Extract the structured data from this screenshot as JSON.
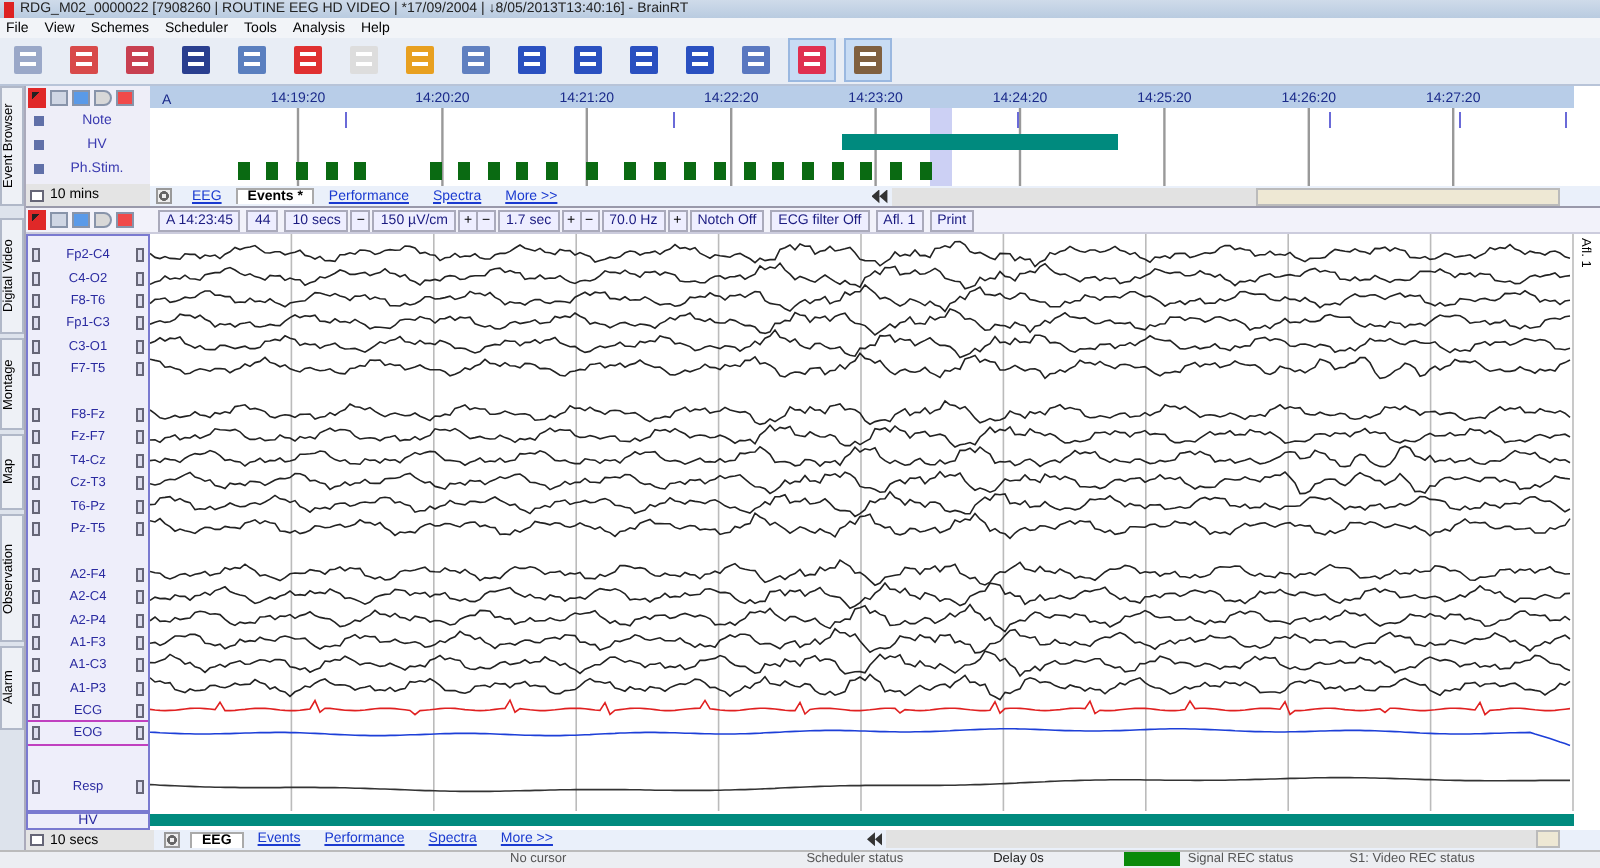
{
  "window": {
    "title": "RDG_M02_0000022 [7908260 | ROUTINE EEG HD VIDEO | *17/09/2004 | ↓8/05/2013T13:40:16] - BrainRT"
  },
  "menu": [
    "File",
    "View",
    "Schemes",
    "Scheduler",
    "Tools",
    "Analysis",
    "Help"
  ],
  "toolbar_buttons": [
    {
      "selected": false
    },
    {
      "selected": false
    },
    {
      "selected": false
    },
    {
      "selected": false
    },
    {
      "selected": false
    },
    {
      "selected": false
    },
    {
      "selected": false
    },
    {
      "selected": false
    },
    {
      "selected": false
    },
    {
      "selected": false
    },
    {
      "selected": false
    },
    {
      "selected": false
    },
    {
      "selected": false
    },
    {
      "selected": false
    },
    {
      "selected": true
    },
    {
      "selected": true
    }
  ],
  "side_tabs": [
    "Event Browser",
    "Digital Video",
    "Montage",
    "Map",
    "Observation",
    "Alarm"
  ],
  "event_browser": {
    "ruler_start": "A",
    "times": [
      "14:19:20",
      "14:20:20",
      "14:21:20",
      "14:22:20",
      "14:23:20",
      "14:24:20",
      "14:25:20",
      "14:26:20",
      "14:27:20"
    ],
    "rows": [
      "Note",
      "HV",
      "Ph.Stim."
    ],
    "span": "10 mins",
    "tabs": [
      {
        "label": "EEG",
        "selected": false
      },
      {
        "label": "Events *",
        "selected": true
      },
      {
        "label": "Performance",
        "selected": false
      },
      {
        "label": "Spectra",
        "selected": false
      },
      {
        "label": "More >>",
        "selected": false
      }
    ]
  },
  "eeg_toolbar": [
    {
      "label": "A 14:23:45",
      "kind": "field"
    },
    {
      "label": "44",
      "kind": "field"
    },
    {
      "label": "10 secs",
      "kind": "field"
    },
    {
      "label": "−",
      "kind": "button"
    },
    {
      "label": "150 µV/cm",
      "kind": "field"
    },
    {
      "label": "+",
      "kind": "button"
    },
    {
      "label": "−",
      "kind": "button"
    },
    {
      "label": "1.7 sec",
      "kind": "field"
    },
    {
      "label": "+",
      "kind": "button"
    },
    {
      "label": "−",
      "kind": "button"
    },
    {
      "label": "70.0 Hz",
      "kind": "field"
    },
    {
      "label": "+",
      "kind": "button"
    },
    {
      "label": "Notch Off",
      "kind": "field"
    },
    {
      "label": "ECG filter Off",
      "kind": "field"
    },
    {
      "label": "Afl. 1",
      "kind": "field"
    },
    {
      "label": "Print",
      "kind": "field"
    }
  ],
  "side_label": "Afl. 1",
  "channel_groups": [
    {
      "channels": [
        {
          "label": "Fp2-C4",
          "kind": "eeg"
        },
        {
          "label": "C4-O2",
          "kind": "eeg"
        },
        {
          "label": "F8-T6",
          "kind": "eeg"
        },
        {
          "label": "Fp1-C3",
          "kind": "eeg"
        },
        {
          "label": "C3-O1",
          "kind": "eeg"
        },
        {
          "label": "F7-T5",
          "kind": "eeg"
        }
      ]
    },
    {
      "channels": [
        {
          "label": "F8-Fz",
          "kind": "eeg"
        },
        {
          "label": "Fz-F7",
          "kind": "eeg"
        },
        {
          "label": "T4-Cz",
          "kind": "eeg"
        },
        {
          "label": "Cz-T3",
          "kind": "eeg"
        },
        {
          "label": "T6-Pz",
          "kind": "eeg"
        },
        {
          "label": "Pz-T5",
          "kind": "eeg"
        }
      ]
    },
    {
      "channels": [
        {
          "label": "A2-F4",
          "kind": "eeg"
        },
        {
          "label": "A2-C4",
          "kind": "eeg"
        },
        {
          "label": "A2-P4",
          "kind": "eeg"
        },
        {
          "label": "A1-F3",
          "kind": "eeg"
        },
        {
          "label": "A1-C3",
          "kind": "eeg"
        },
        {
          "label": "A1-P3",
          "kind": "eeg"
        },
        {
          "label": "ECG",
          "kind": "ecg"
        },
        {
          "label": "EOG",
          "kind": "eog"
        }
      ]
    },
    {
      "channels": [
        {
          "label": "Resp",
          "kind": "resp"
        }
      ]
    }
  ],
  "hv_channel": "HV",
  "eeg_span": "10 secs",
  "eeg_tabs": [
    {
      "label": "EEG",
      "selected": true
    },
    {
      "label": "Events",
      "selected": false
    },
    {
      "label": "Performance",
      "selected": false
    },
    {
      "label": "Spectra",
      "selected": false
    },
    {
      "label": "More >>",
      "selected": false
    }
  ],
  "status_bar": {
    "cursor": "No cursor",
    "scheduler": "Scheduler status",
    "delay": "Delay  0s",
    "signal": "Signal REC status",
    "video": "S1: Video REC status"
  }
}
